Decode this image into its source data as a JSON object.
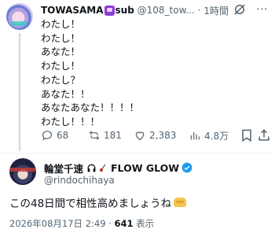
{
  "post": {
    "author_name": "TOWASAMA",
    "author_suffix": "sub",
    "handle": "@108_tow...",
    "separator": "·",
    "time": "1時間",
    "lines": [
      "わたし！",
      "わたし！",
      "あなた！",
      "わたし！",
      "わたし？",
      "あなた！！",
      "あなたあなた！！！！",
      "わたし！！！"
    ],
    "actions": {
      "replies": "68",
      "reposts": "181",
      "likes": "2,383",
      "views": "4.8万"
    }
  },
  "quoted": {
    "author_name": "輪堂千速",
    "author_suffix": "FLOW GLOW",
    "handle": "@rindochihaya",
    "text": "この48日間で相性高めましょうね",
    "date": "2026年08月17日 2:49",
    "dot": "·",
    "views_count": "641",
    "views_label": "表示"
  },
  "colors": {
    "text": "#0f1419",
    "muted": "#536471",
    "verified": "#1d9bf0",
    "divider": "#eff3f4"
  },
  "icons": [
    "grok-icon",
    "more-icon",
    "reply-icon",
    "repost-icon",
    "like-icon",
    "views-icon",
    "bookmark-icon",
    "share-icon",
    "headphones-icon",
    "guitar-icon",
    "verified-icon",
    "handshake-icon"
  ]
}
